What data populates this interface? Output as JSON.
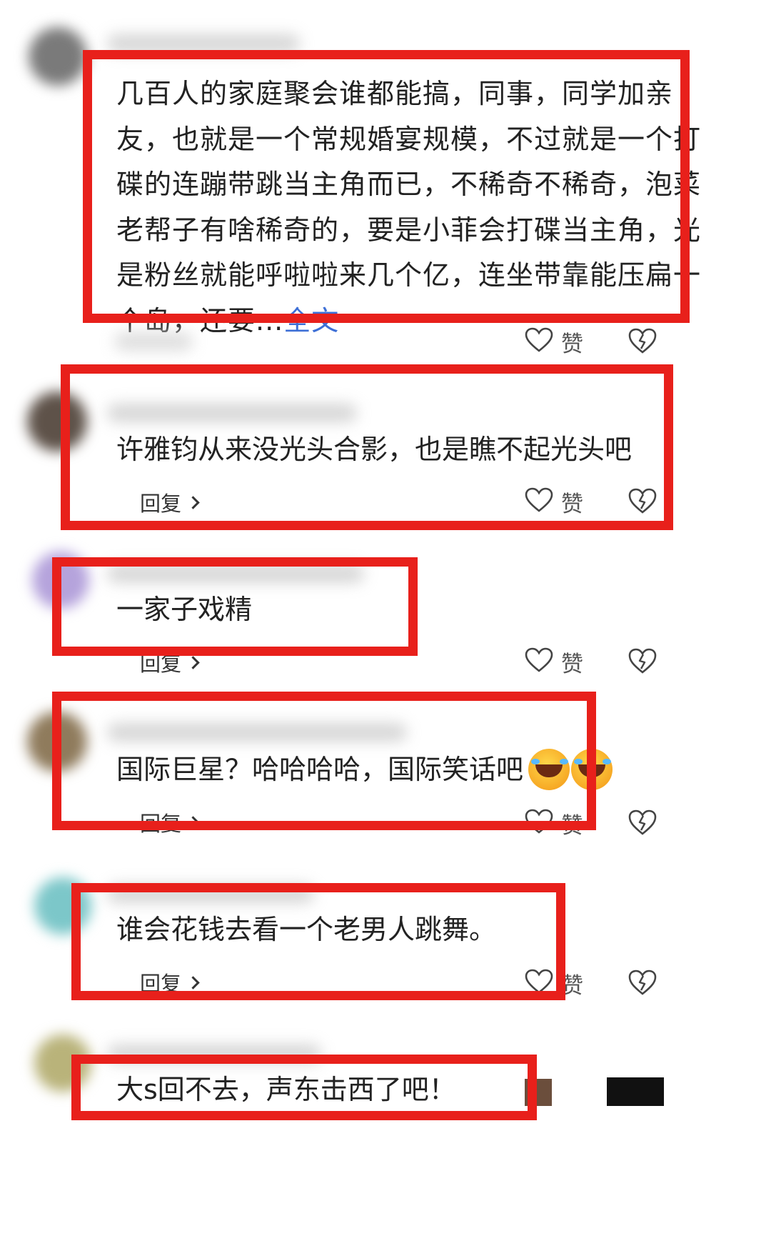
{
  "comments": [
    {
      "text": "几百人的家庭聚会谁都能搞，同事，同学加亲友，也就是一个常规婚宴规模，不过就是一个打碟的连蹦带跳当主角而已，不稀奇不稀奇，泡菜老帮子有啥稀奇的，要是小菲会打碟当主角，光是粉丝就能呼啦啦来几个亿，连坐带靠能压扁一个岛，还要...",
      "more_label": "全文",
      "like_label": "赞"
    },
    {
      "text": "许雅钧从来没光头合影，也是瞧不起光头吧",
      "reply_label": "回复",
      "like_label": "赞"
    },
    {
      "text": "一家子戏精",
      "reply_label": "回复",
      "like_label": "赞"
    },
    {
      "text": "国际巨星？哈哈哈哈，国际笑话吧",
      "reply_label": "回复",
      "like_label": "赞"
    },
    {
      "text": "谁会花钱去看一个老男人跳舞。",
      "reply_label": "回复",
      "like_label": "赞"
    },
    {
      "text": "大s回不去，声东击西了吧！"
    }
  ],
  "colors": {
    "highlight_box": "#e8201b",
    "more_link": "#3d6fd6",
    "text": "#222222"
  },
  "icons": [
    "heart-outline-icon",
    "broken-heart-icon",
    "chevron-right-icon",
    "laughing-crying-emoji-icon"
  ]
}
